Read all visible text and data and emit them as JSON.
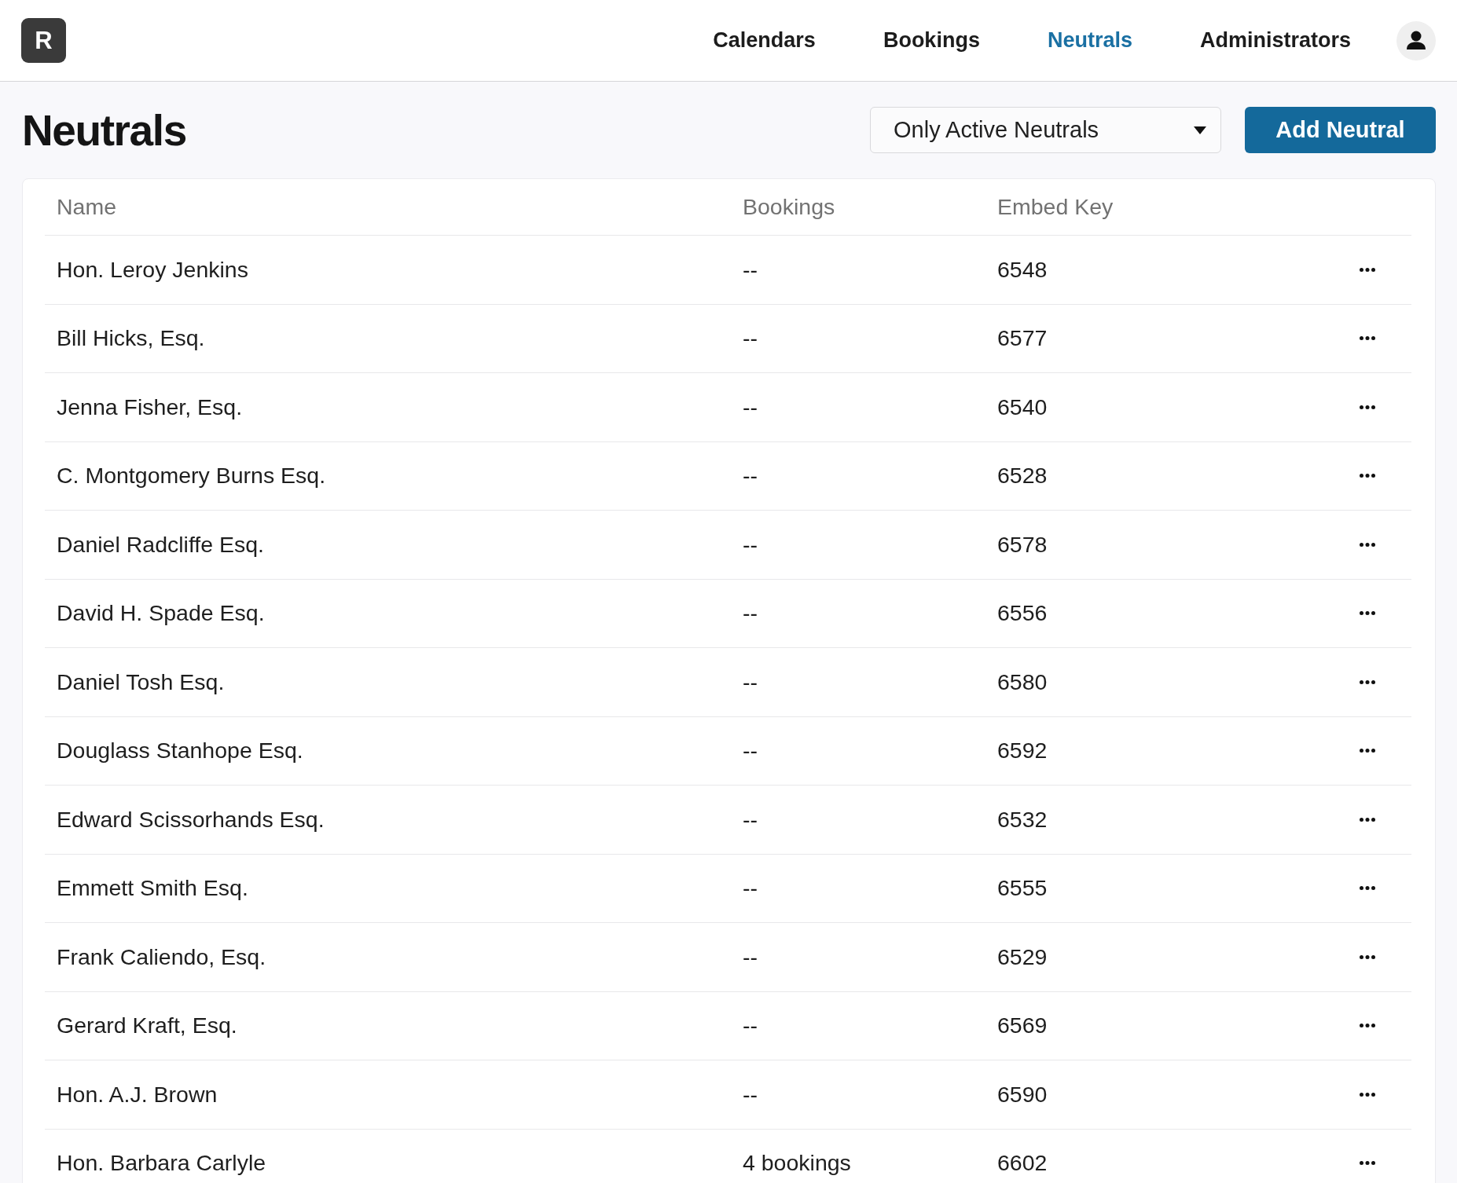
{
  "logo": {
    "letter": "R"
  },
  "nav": {
    "items": [
      {
        "label": "Calendars",
        "selected": false
      },
      {
        "label": "Bookings",
        "selected": false
      },
      {
        "label": "Neutrals",
        "selected": true
      },
      {
        "label": "Administrators",
        "selected": false
      }
    ]
  },
  "page": {
    "title": "Neutrals",
    "filter": {
      "value": "Only Active Neutrals"
    },
    "add_button": "Add Neutral"
  },
  "table": {
    "columns": [
      "Name",
      "Bookings",
      "Embed Key"
    ],
    "rows": [
      {
        "name": "Hon. Leroy Jenkins",
        "bookings": "--",
        "embed_key": "6548"
      },
      {
        "name": "Bill Hicks, Esq.",
        "bookings": "--",
        "embed_key": "6577"
      },
      {
        "name": "Jenna Fisher, Esq.",
        "bookings": "--",
        "embed_key": "6540"
      },
      {
        "name": "C. Montgomery Burns Esq.",
        "bookings": "--",
        "embed_key": "6528"
      },
      {
        "name": "Daniel Radcliffe Esq.",
        "bookings": "--",
        "embed_key": "6578"
      },
      {
        "name": "David H. Spade Esq.",
        "bookings": "--",
        "embed_key": "6556"
      },
      {
        "name": "Daniel Tosh Esq.",
        "bookings": "--",
        "embed_key": "6580"
      },
      {
        "name": "Douglass Stanhope Esq.",
        "bookings": "--",
        "embed_key": "6592"
      },
      {
        "name": "Edward Scissorhands Esq.",
        "bookings": "--",
        "embed_key": "6532"
      },
      {
        "name": "Emmett Smith Esq.",
        "bookings": "--",
        "embed_key": "6555"
      },
      {
        "name": "Frank Caliendo, Esq.",
        "bookings": "--",
        "embed_key": "6529"
      },
      {
        "name": "Gerard Kraft, Esq.",
        "bookings": "--",
        "embed_key": "6569"
      },
      {
        "name": "Hon. A.J. Brown",
        "bookings": "--",
        "embed_key": "6590"
      },
      {
        "name": "Hon. Barbara Carlyle",
        "bookings": "4 bookings",
        "embed_key": "6602"
      }
    ]
  }
}
